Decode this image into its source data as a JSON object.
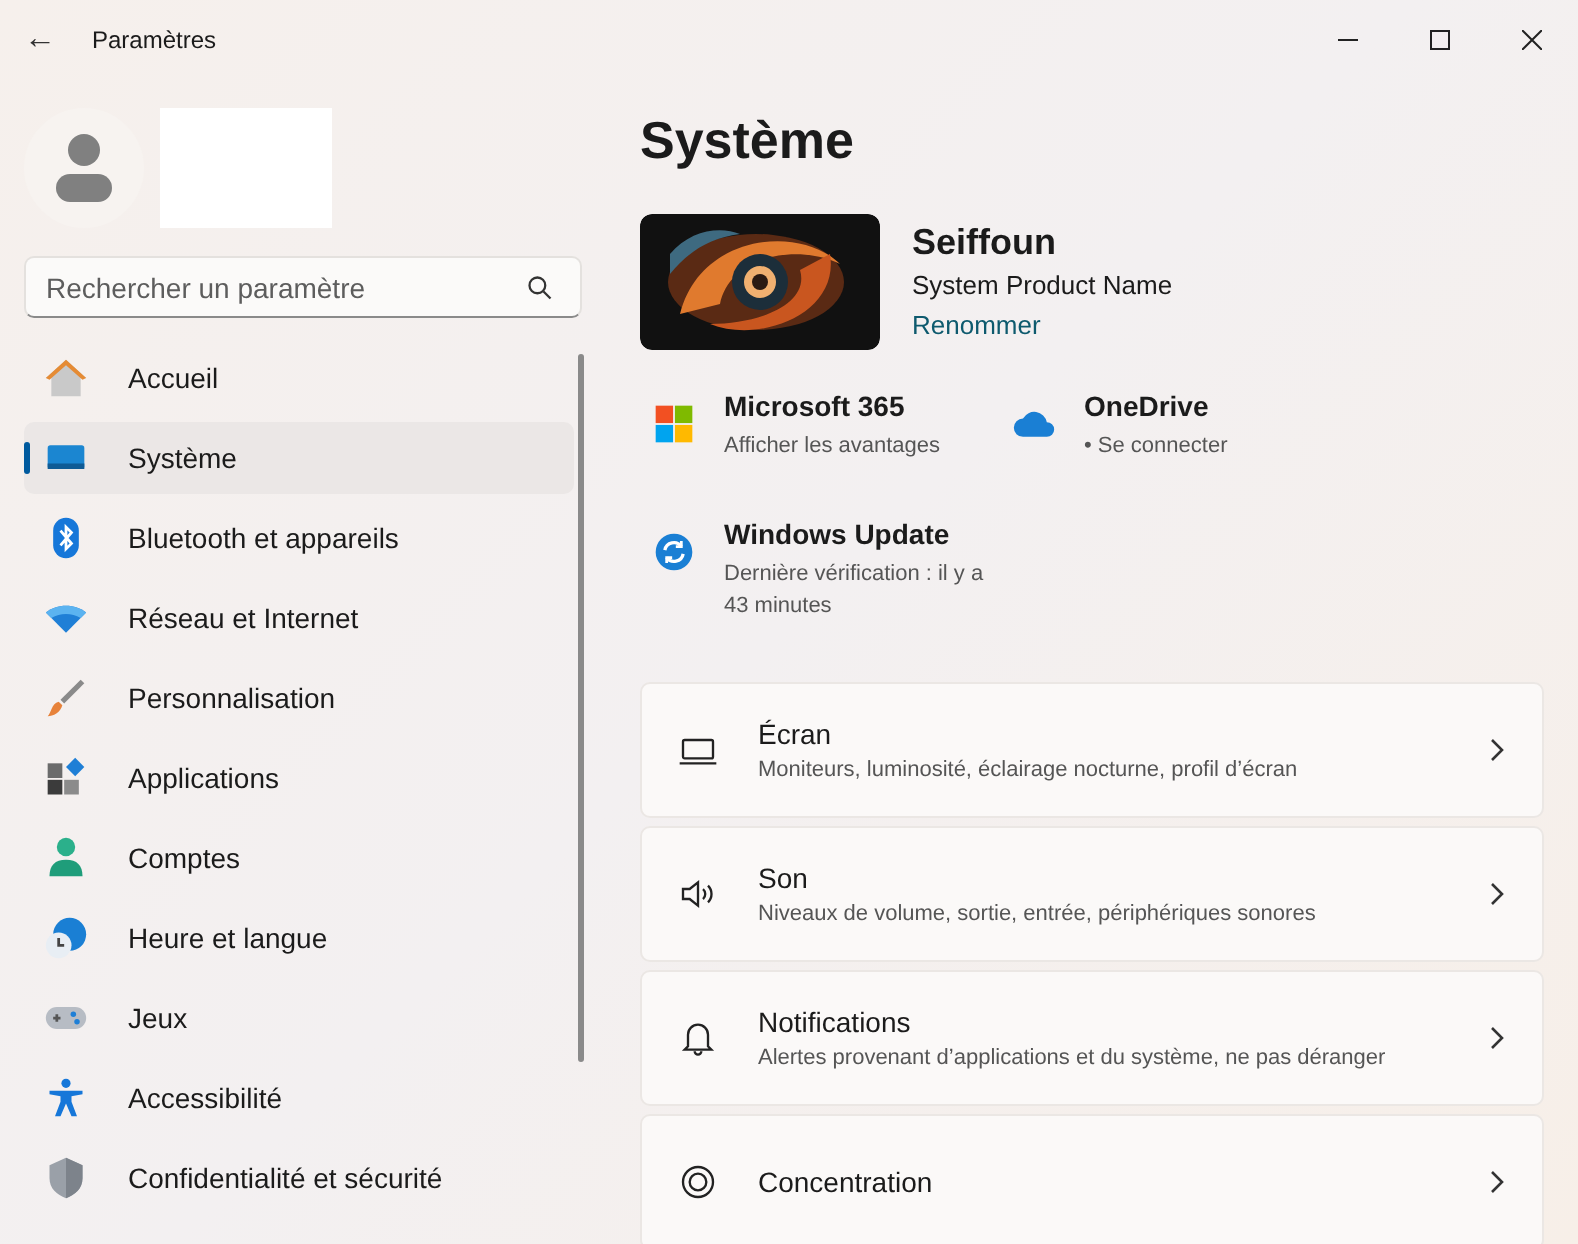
{
  "window": {
    "title": "Paramètres",
    "back": "←"
  },
  "search": {
    "placeholder": "Rechercher un paramètre"
  },
  "sidebar": {
    "items": [
      {
        "label": "Accueil",
        "kind": "home",
        "selected": false
      },
      {
        "label": "Système",
        "kind": "system",
        "selected": true
      },
      {
        "label": "Bluetooth et appareils",
        "kind": "bluetooth",
        "selected": false
      },
      {
        "label": "Réseau et Internet",
        "kind": "wifi",
        "selected": false
      },
      {
        "label": "Personnalisation",
        "kind": "brush",
        "selected": false
      },
      {
        "label": "Applications",
        "kind": "apps",
        "selected": false
      },
      {
        "label": "Comptes",
        "kind": "person",
        "selected": false
      },
      {
        "label": "Heure et langue",
        "kind": "clock",
        "selected": false
      },
      {
        "label": "Jeux",
        "kind": "gamepad",
        "selected": false
      },
      {
        "label": "Accessibilité",
        "kind": "accessibility",
        "selected": false
      },
      {
        "label": "Confidentialité et sécurité",
        "kind": "shield",
        "selected": false
      }
    ]
  },
  "page": {
    "title": "Système",
    "device": {
      "name": "Seiffoun",
      "model": "System Product Name",
      "rename": "Renommer"
    },
    "tiles": [
      {
        "kind": "microsoft",
        "title": "Microsoft 365",
        "subtitle": "Afficher les avantages"
      },
      {
        "kind": "cloud",
        "title": "OneDrive",
        "subtitle": "• Se connecter"
      },
      {
        "kind": "update",
        "title": "Windows Update",
        "subtitle": "Dernière vérification : il y a 43 minutes"
      }
    ],
    "cards": [
      {
        "kind": "display",
        "title": "Écran",
        "subtitle": "Moniteurs, luminosité, éclairage nocturne, profil d’écran"
      },
      {
        "kind": "sound",
        "title": "Son",
        "subtitle": "Niveaux de volume, sortie, entrée, périphériques sonores"
      },
      {
        "kind": "bell",
        "title": "Notifications",
        "subtitle": "Alertes provenant d’applications et du système, ne pas déranger"
      },
      {
        "kind": "focus",
        "title": "Concentration"
      }
    ]
  }
}
